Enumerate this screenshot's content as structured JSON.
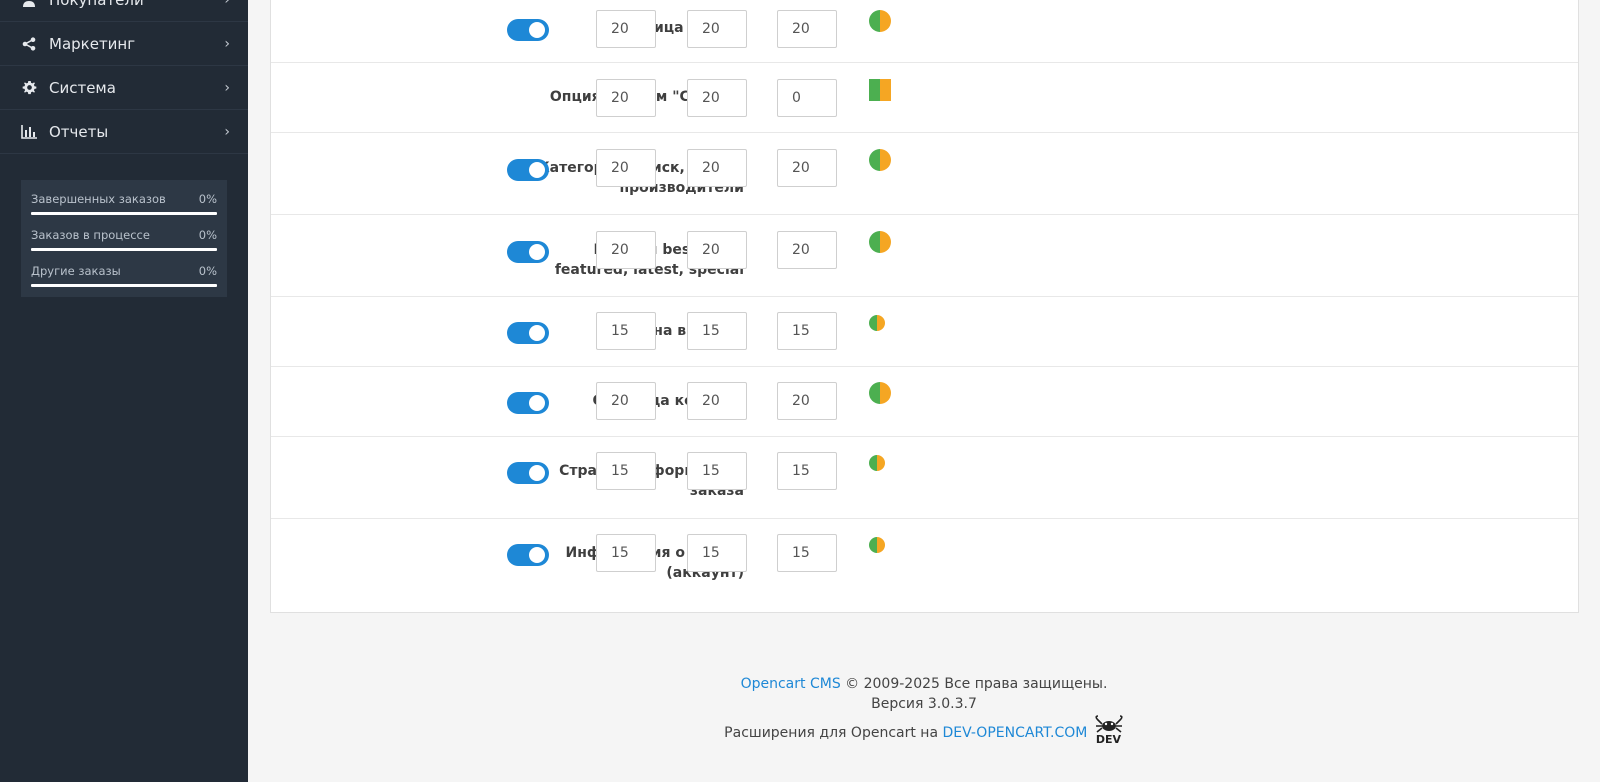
{
  "sidebar": {
    "items": [
      {
        "label": "Покупатели",
        "icon": "user-icon"
      },
      {
        "label": "Маркетинг",
        "icon": "share-icon"
      },
      {
        "label": "Система",
        "icon": "gear-icon"
      },
      {
        "label": "Отчеты",
        "icon": "bar-chart-icon"
      }
    ],
    "stats": [
      {
        "label": "Завершенных заказов",
        "value": "0%",
        "progress": 0
      },
      {
        "label": "Заказов в процессе",
        "value": "0%",
        "progress": 0
      },
      {
        "label": "Другие заказы",
        "value": "0%",
        "progress": 0
      }
    ]
  },
  "settings": {
    "rows": [
      {
        "label": "Страница товара",
        "toggle": true,
        "values": [
          "20",
          "20",
          "20"
        ],
        "indicator": "circle-large"
      },
      {
        "label": "Опция с типом \"Список\"",
        "toggle": null,
        "values": [
          "20",
          "20",
          "0"
        ],
        "indicator": "square"
      },
      {
        "label": "Категория, поиск, акции, производители",
        "toggle": true,
        "values": [
          "20",
          "20",
          "20"
        ],
        "indicator": "circle-large"
      },
      {
        "label": "Модули bestseller, featured, latest, special",
        "toggle": true,
        "values": [
          "20",
          "20",
          "20"
        ],
        "indicator": "circle-large"
      },
      {
        "label": "Корзина в шапке",
        "toggle": true,
        "values": [
          "15",
          "15",
          "15"
        ],
        "indicator": "circle-small"
      },
      {
        "label": "Страница корзины",
        "toggle": true,
        "values": [
          "20",
          "20",
          "20"
        ],
        "indicator": "circle-large"
      },
      {
        "label": "Страница оформления заказа",
        "toggle": true,
        "values": [
          "15",
          "15",
          "15"
        ],
        "indicator": "circle-small"
      },
      {
        "label": "Информация о заказе (аккаунт)",
        "toggle": true,
        "values": [
          "15",
          "15",
          "15"
        ],
        "indicator": "circle-small"
      }
    ],
    "colors": {
      "green": "#4caf50",
      "orange": "#f5a623",
      "toggle": "#1e88d6"
    }
  },
  "footer": {
    "cms_link": "Opencart CMS",
    "copyright": "© 2009-2025 Все права защищены.",
    "version": "Версия 3.0.3.7",
    "extensions_text": "Расширения для Opencart на",
    "dev_link": "DEV-OPENCART.COM",
    "logo_text": "DEV"
  }
}
